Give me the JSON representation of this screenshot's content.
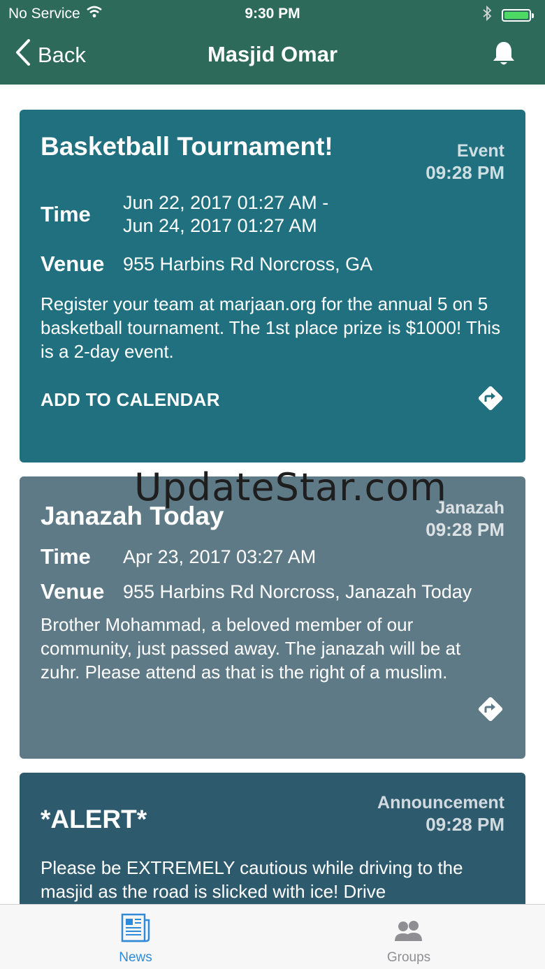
{
  "status_bar": {
    "carrier": "No Service",
    "time": "9:30 PM"
  },
  "nav": {
    "back_label": "Back",
    "title": "Masjid Omar",
    "bell_icon": "bell-icon"
  },
  "cards": [
    {
      "title": "Basketball Tournament!",
      "type": "Event",
      "time": "09:28 PM",
      "time_label": "Time",
      "time_value_1": "Jun 22, 2017 01:27 AM -",
      "time_value_2": "Jun 24, 2017 01:27 AM",
      "venue_label": "Venue",
      "venue_value": "955 Harbins Rd Norcross, GA",
      "description": "Register your team at marjaan.org for the annual 5 on 5 basketball tournament. The 1st place prize is $1000! This is a 2-day event.",
      "action_label": "ADD TO CALENDAR",
      "color": "#20707f"
    },
    {
      "title": "Janazah Today",
      "type": "Janazah",
      "time": "09:28 PM",
      "time_label": "Time",
      "time_value_1": "Apr 23, 2017 03:27 AM",
      "venue_label": "Venue",
      "venue_value": "955 Harbins Rd Norcross, Janazah Today",
      "description": "Brother Mohammad, a beloved member of our community, just passed away. The janazah will be at zuhr. Please attend as that is the right of a muslim.",
      "color": "#5f7a87"
    },
    {
      "title": "*ALERT*",
      "type": "Announcement",
      "time": "09:28 PM",
      "description": "Please be EXTREMELY cautious while driving to the masjid as the road is slicked with ice! Drive",
      "color": "#2e5a6e"
    }
  ],
  "watermark": "UpdateStar.com",
  "tabs": [
    {
      "label": "News",
      "icon": "newspaper-icon",
      "active": true,
      "color": "#2f8bd8"
    },
    {
      "label": "Groups",
      "icon": "group-icon",
      "active": false,
      "color": "#8e8e93"
    }
  ]
}
